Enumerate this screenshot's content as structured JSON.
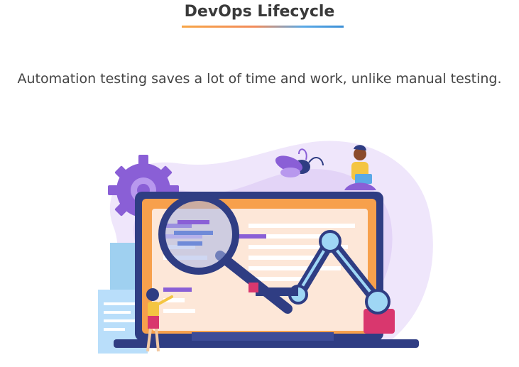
{
  "header": {
    "title": "DevOps Lifecycle"
  },
  "content": {
    "subtitle": "Automation testing saves a lot of time and work, unlike manual testing."
  },
  "illustration": {
    "description_icon": "automation-testing-illustration"
  },
  "colors": {
    "title": "#3a3a3a",
    "underline_start": "#f7a546",
    "underline_end": "#3b8fd6",
    "blob": "#efe6fb",
    "gear": "#8a5fd6",
    "laptop_frame": "#2f3d83",
    "screen": "#f7a04c",
    "panel": "#fde7d8",
    "robot_arm": "#2f3d83",
    "joint": "#9fd7f5"
  }
}
